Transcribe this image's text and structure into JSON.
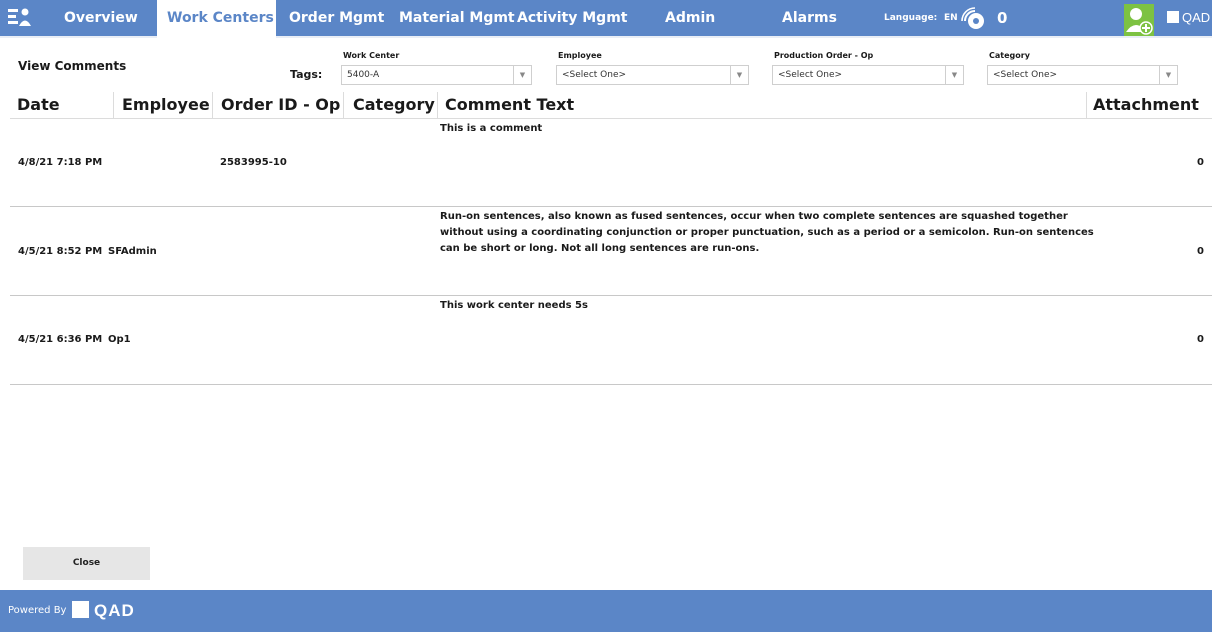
{
  "nav": {
    "tabs": [
      {
        "label": "Overview",
        "active": false
      },
      {
        "label": "Work Centers",
        "active": true
      },
      {
        "label": "Order Mgmt",
        "active": false
      },
      {
        "label": "Material Mgmt",
        "active": false
      },
      {
        "label": "Activity Mgmt",
        "active": false
      },
      {
        "label": "Admin",
        "active": false
      },
      {
        "label": "Alarms",
        "active": false
      }
    ],
    "language_label": "Language:",
    "language_value": "EN",
    "alarm_count": "0",
    "brand": "QAD",
    "icons": {
      "app": "workcenter-icon",
      "alarm": "alarm-bell-icon",
      "user": "add-user-icon",
      "brand": "qad-logo-icon"
    }
  },
  "filters": {
    "title": "View Comments",
    "tags_label": "Tags:",
    "work_center": {
      "label": "Work Center",
      "value": "5400-A"
    },
    "employee": {
      "label": "Employee",
      "value": "<Select One>"
    },
    "production_order": {
      "label": "Production Order - Op",
      "value": "<Select One>"
    },
    "category": {
      "label": "Category",
      "value": "<Select One>"
    }
  },
  "table": {
    "columns": [
      "Date",
      "Employee",
      "Order ID - Op",
      "Category",
      "Comment Text",
      "Attachment"
    ],
    "rows": [
      {
        "date": "4/8/21 7:18 PM",
        "employee": "",
        "order": "2583995-10",
        "category": "",
        "comment": "This is a comment",
        "attachment": "0"
      },
      {
        "date": "4/5/21 8:52 PM",
        "employee": "SFAdmin",
        "order": "",
        "category": "",
        "comment": "Run-on sentences, also known as fused sentences, occur when two complete sentences are squashed together without using a coordinating conjunction or proper punctuation, such as a period or a semicolon. Run-on sentences can be short or long. Not all long sentences are run-ons.",
        "attachment": "0"
      },
      {
        "date": "4/5/21 6:36 PM",
        "employee": "Op1",
        "order": "",
        "category": "",
        "comment": "This work center needs 5s",
        "attachment": "0"
      }
    ]
  },
  "close_label": "Close",
  "footer": {
    "powered_by": "Powered By",
    "brand": "QAD"
  },
  "colors": {
    "primary": "#5b86c7",
    "accent_green": "#7dc242",
    "button_bg": "#e6e6e6"
  }
}
